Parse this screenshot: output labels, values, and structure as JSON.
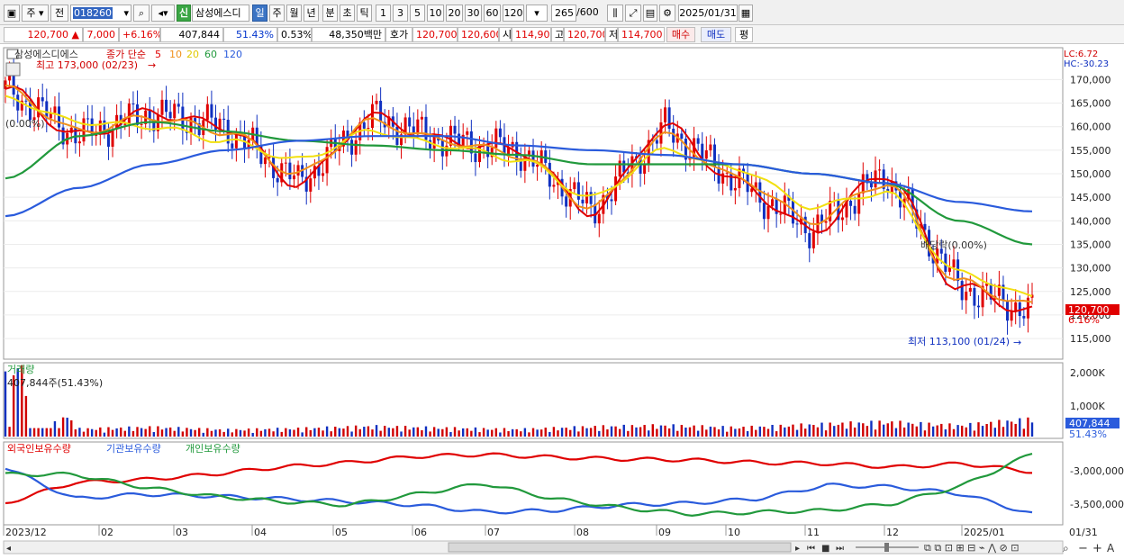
{
  "toolbar": {
    "market_label": "주",
    "prev_label": "전",
    "stock_code": "018260",
    "shin_label": "신",
    "stock_name": "삼성에스디",
    "period_tabs": [
      "일",
      "주",
      "월",
      "년",
      "분",
      "초",
      "틱"
    ],
    "interval_buttons": [
      "1",
      "3",
      "5",
      "10",
      "20",
      "30",
      "60",
      "120"
    ],
    "count": "265",
    "count_max": "/600",
    "date": "2025/01/31"
  },
  "quote": {
    "price": "120,700",
    "change": "7,000",
    "change_pct": "+6.16%",
    "volume": "407,844",
    "volume_ratio": "51.43%",
    "turnover_rate": "0.53%",
    "amount": "48,350백만",
    "bid_label": "호가",
    "ask_price": "120,700",
    "bid_price": "120,600",
    "open_label": "시",
    "open": "114,900",
    "high_label": "고",
    "high": "120,700",
    "low_label": "저",
    "low": "114,700",
    "buy_label": "매수",
    "sell_label": "매도",
    "avg_label": "평"
  },
  "price_panel": {
    "stock_label": "삼성에스디에스",
    "ma_label": "종가 단순",
    "ma_periods": [
      "5",
      "10",
      "20",
      "60",
      "120"
    ],
    "ma_colors": [
      "#e00000",
      "#f0901a",
      "#f2e010",
      "#21993c",
      "#2a5bdc"
    ],
    "high_marker": "최고 173,000 (02/23)",
    "low_marker": "최저 113,100 (01/24)",
    "left_pct": "(0.00%)",
    "mid_label": "배당락(0.00%)",
    "lc": "LC:6.72",
    "hc": "HC:-30.23",
    "last_price": "120,700",
    "last_pct": "6.16%",
    "y_ticks": [
      "170,000",
      "165,000",
      "160,000",
      "155,000",
      "150,000",
      "145,000",
      "140,000",
      "135,000",
      "130,000",
      "125,000",
      "120,000",
      "115,000"
    ]
  },
  "volume_panel": {
    "label": "거래량",
    "readout": "407,844주(51.43%)",
    "y_ticks": [
      "2,000K",
      "1,000K"
    ],
    "last_volume": "407,844",
    "last_pct": "51.43%"
  },
  "holdings_panel": {
    "labels": [
      "외국인보유수량",
      "기관보유수량",
      "개인보유수량"
    ],
    "colors": [
      "#e00000",
      "#2a5bdc",
      "#21993c"
    ],
    "y_ticks": [
      "-3,000,000",
      "-3,500,000"
    ]
  },
  "x_axis": {
    "labels": [
      "2023/12",
      "02",
      "03",
      "04",
      "05",
      "06",
      "07",
      "08",
      "09",
      "10",
      "11",
      "12",
      "2025/01"
    ],
    "right_label": "01/31"
  },
  "chart_data": {
    "type": "line",
    "ylim": [
      111000,
      176000
    ],
    "price_dates": [
      "2023-12",
      "2024-01",
      "2024-02",
      "2024-03",
      "2024-04",
      "2024-05",
      "2024-06",
      "2024-07",
      "2024-08",
      "2024-09",
      "2024-10",
      "2024-11",
      "2024-12",
      "2025-01",
      "2025-01-31"
    ],
    "series": [
      {
        "name": "5",
        "values": [
          168000,
          158000,
          163000,
          160000,
          148000,
          162000,
          157000,
          155000,
          142000,
          160000,
          148000,
          138000,
          150000,
          126000,
          120700
        ]
      },
      {
        "name": "10",
        "values": [
          168000,
          159000,
          162000,
          159000,
          150000,
          161000,
          157000,
          154000,
          143000,
          158000,
          149000,
          140000,
          148000,
          127000,
          122000
        ]
      },
      {
        "name": "20",
        "values": [
          166000,
          161000,
          160000,
          157000,
          153000,
          159000,
          156000,
          153000,
          145000,
          155000,
          151000,
          143000,
          146000,
          129000,
          124000
        ]
      },
      {
        "name": "60",
        "values": [
          149000,
          158000,
          161000,
          159000,
          157000,
          156000,
          155000,
          154000,
          152000,
          152000,
          152000,
          150000,
          148000,
          140000,
          135000
        ]
      },
      {
        "name": "120",
        "values": [
          141000,
          147000,
          152000,
          155000,
          157000,
          158000,
          158000,
          156000,
          155000,
          154000,
          152000,
          150000,
          148000,
          144000,
          142000
        ]
      }
    ],
    "volume_values": [
      2000,
      180,
      220,
      160,
      190,
      240,
      200,
      170,
      230,
      260,
      210,
      280,
      340,
      260,
      408
    ]
  }
}
